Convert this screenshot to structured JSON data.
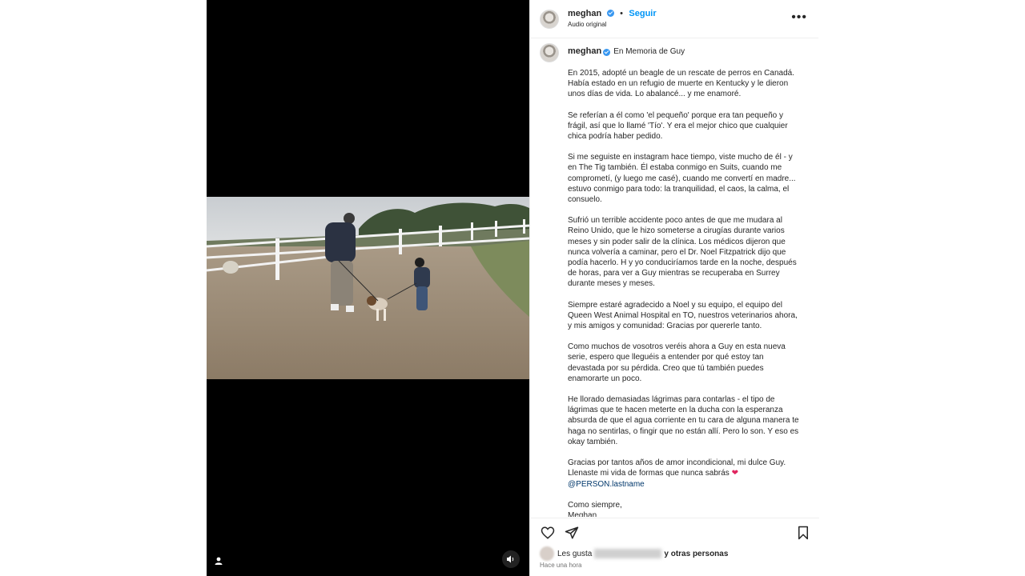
{
  "post": {
    "username": "meghan",
    "follow_label": "Seguir",
    "audio_label": "Audio original",
    "more_icon": "more-horizontal-icon"
  },
  "caption": {
    "username": "meghan",
    "title": "En Memoria de Guy",
    "paragraphs": [
      "En 2015, adopté un beagle de un rescate de perros en Canadá.\nHabía estado en un refugio de muerte en Kentucky y le dieron\nunos días de vida. Lo abalancé... y me enamoré.",
      "Se referían a él como 'el pequeño' porque era tan pequeño y\nfrágil, así que lo llamé 'Tío'. Y era el mejor chico que cualquier\nchica podría haber pedido.",
      "Si me seguiste en instagram hace tiempo, viste mucho de él - y\nen The Tig también. Él estaba conmigo en Suits, cuando me\ncomprometí, (y luego me casé), cuando me convertí en madre...\nestuvo conmigo para todo: la tranquilidad, el caos, la calma, el\nconsuelo.",
      "Sufrió un terrible accidente poco antes de que me mudara al\nReino Unido, que le hizo someterse a cirugías durante varios\nmeses y sin poder salir de la clínica. Los médicos dijeron que\nnunca volvería a caminar, pero el Dr. Noel Fitzpatrick dijo que\npodía hacerlo. H y yo conduciríamos tarde en la noche, después\nde horas, para ver a Guy mientras se recuperaba en Surrey\ndurante meses y meses.",
      "Siempre estaré agradecido a Noel y su equipo, el equipo del\nQueen West Animal Hospital en TO, nuestros veterinarios ahora,\ny mis amigos y comunidad: Gracias por quererle tanto.",
      "Como muchos de vosotros veréis ahora a Guy en esta nueva\nserie, espero que lleguéis a entender por qué estoy tan\ndevastada por su pérdida. Creo que tú también puedes\nenamorarte un poco.",
      "He llorado demasiadas lágrimas para contarlas - el tipo de\nlágrimas que te hacen meterte en la ducha con la esperanza\nabsurda de que el agua corriente en tu cara de alguna manera te\nhaga no sentirlas, o fingir que no están allí. Pero lo son. Y eso es\nokay también."
    ],
    "closing_text": "Gracias por tantos años de amor incondicional, mi dulce Guy.\nLlenaste mi vida de formas que nunca sabrás",
    "heart_emoji": "❤",
    "mention": "@PERSON.lastname",
    "signoff": "Como siempre,\nMeghan"
  },
  "likes": {
    "prefix": "Les gusta",
    "suffix": "y otras personas"
  },
  "timestamp": "Hace una hora",
  "icons": [
    "heart-icon",
    "share-icon",
    "bookmark-icon",
    "user-tag-icon",
    "audio-icon"
  ]
}
